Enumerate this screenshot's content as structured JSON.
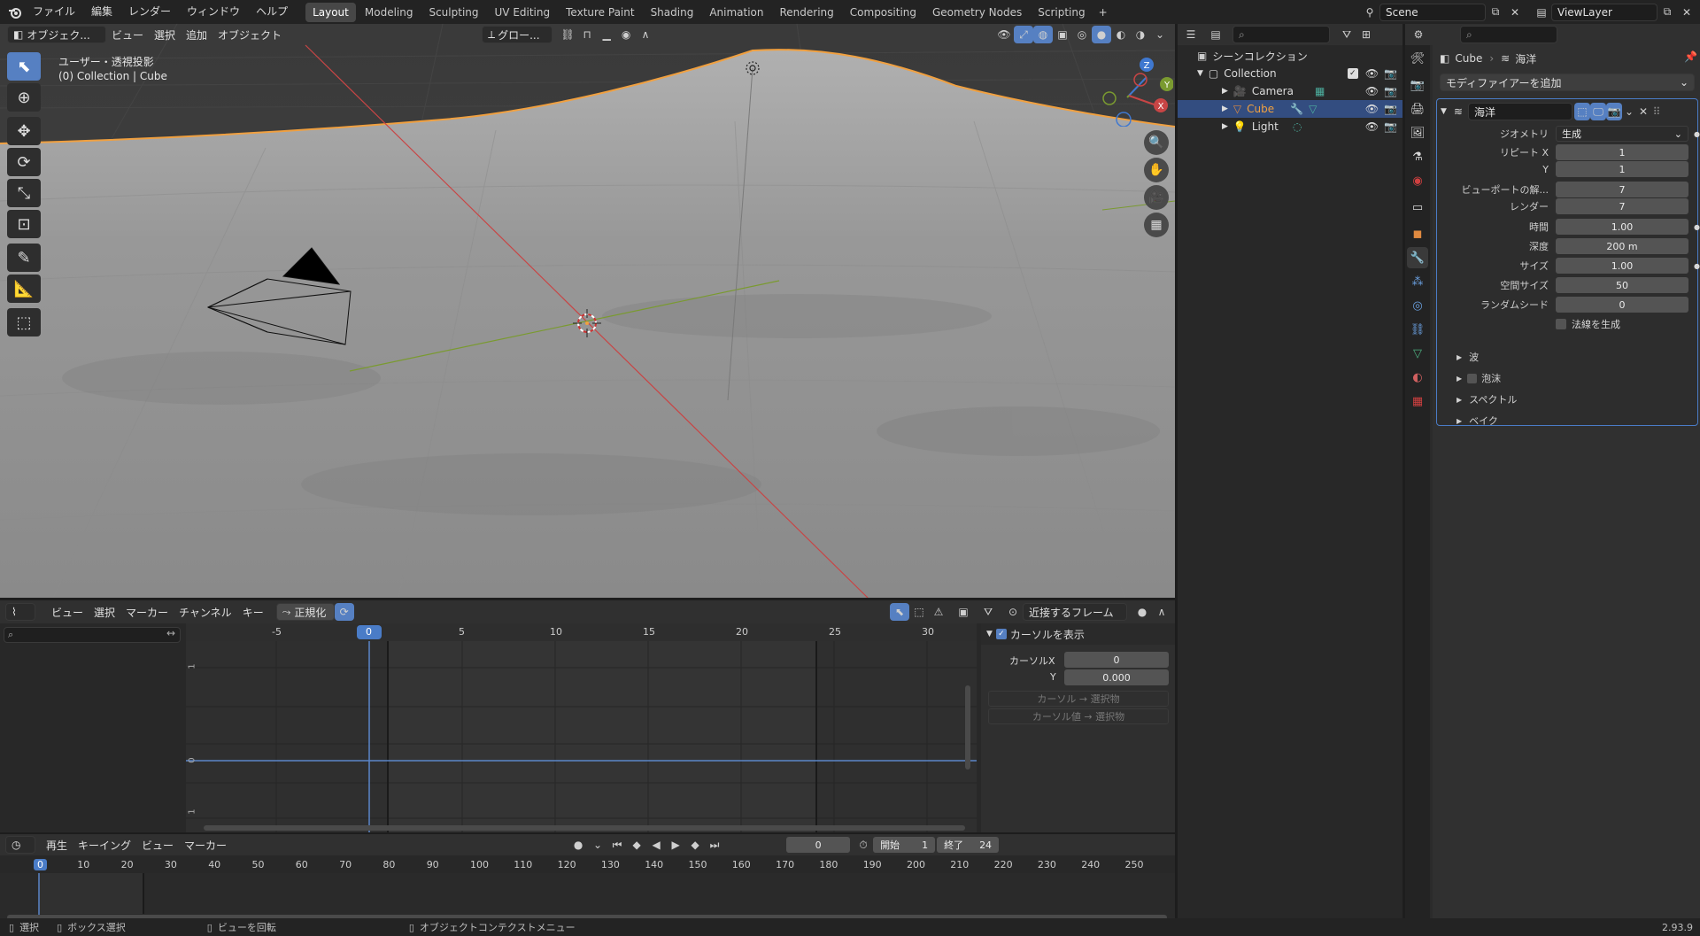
{
  "topbar": {
    "menus": [
      "ファイル",
      "編集",
      "レンダー",
      "ウィンドウ",
      "ヘルプ"
    ],
    "workspaces": [
      "Layout",
      "Modeling",
      "Sculpting",
      "UV Editing",
      "Texture Paint",
      "Shading",
      "Animation",
      "Rendering",
      "Compositing",
      "Geometry Nodes",
      "Scripting"
    ],
    "active_workspace": "Layout",
    "scene": "Scene",
    "view_layer": "ViewLayer"
  },
  "viewport": {
    "mode": "オブジェク...",
    "menus": [
      "ビュー",
      "選択",
      "追加",
      "オブジェクト"
    ],
    "orientation": "グロー...",
    "overlay_title": "ユーザー・透視投影",
    "overlay_subtitle": "(0) Collection | Cube",
    "gizmo": {
      "z": "Z",
      "y": "Y",
      "x": "X"
    }
  },
  "graph_editor": {
    "menus": [
      "ビュー",
      "選択",
      "マーカー",
      "チャンネル",
      "キー"
    ],
    "normalize": "正規化",
    "pivot": "近接するフレーム",
    "ruler": [
      "-5",
      "0",
      "5",
      "10",
      "15",
      "20",
      "25",
      "30"
    ],
    "current_frame": "0",
    "y_labels": [
      "1",
      "0",
      "1"
    ],
    "sidebar": {
      "show_cursor": "カーソルを表示",
      "cursor_x_label": "カーソルX",
      "cursor_x": "0",
      "y_label": "Y",
      "y_value": "0.000",
      "btn1": "カーソル → 選択物",
      "btn2": "カーソル値 → 選択物"
    }
  },
  "timeline": {
    "menus": [
      "再生",
      "キーイング",
      "ビュー",
      "マーカー"
    ],
    "frame": "0",
    "start_label": "開始",
    "start": "1",
    "end_label": "終了",
    "end": "24",
    "ruler": [
      "0",
      "10",
      "20",
      "30",
      "40",
      "50",
      "60",
      "70",
      "80",
      "90",
      "100",
      "110",
      "120",
      "130",
      "140",
      "150",
      "160",
      "170",
      "180",
      "190",
      "200",
      "210",
      "220",
      "230",
      "240",
      "250"
    ]
  },
  "statusbar": {
    "select": "選択",
    "box_select": "ボックス選択",
    "rotate_view": "ビューを回転",
    "context_menu": "オブジェクトコンテクストメニュー",
    "version": "2.93.9"
  },
  "outliner": {
    "scene_collection": "シーンコレクション",
    "collection": "Collection",
    "items": [
      "Camera",
      "Cube",
      "Light"
    ]
  },
  "properties": {
    "breadcrumb_object": "Cube",
    "breadcrumb_modifier": "海洋",
    "add_modifier": "モディファイアーを追加",
    "modifier_name": "海洋",
    "fields": [
      {
        "label": "ジオメトリ",
        "value": "生成"
      },
      {
        "label": "リピート X",
        "value": "1"
      },
      {
        "label": "Y",
        "value": "1"
      },
      {
        "label": "ビューポートの解...",
        "value": "7"
      },
      {
        "label": "レンダー",
        "value": "7"
      },
      {
        "label": "時間",
        "value": "1.00"
      },
      {
        "label": "深度",
        "value": "200 m"
      },
      {
        "label": "サイズ",
        "value": "1.00"
      },
      {
        "label": "空間サイズ",
        "value": "50"
      },
      {
        "label": "ランダムシード",
        "value": "0"
      }
    ],
    "generate_normals": "法線を生成",
    "subpanels": [
      "波",
      "泡沫",
      "スペクトル",
      "ベイク"
    ]
  },
  "colors": {
    "accent": "#5680c2",
    "selected_object": "#f0a040",
    "x_axis": "#c84545",
    "y_axis": "#7a9a30"
  }
}
